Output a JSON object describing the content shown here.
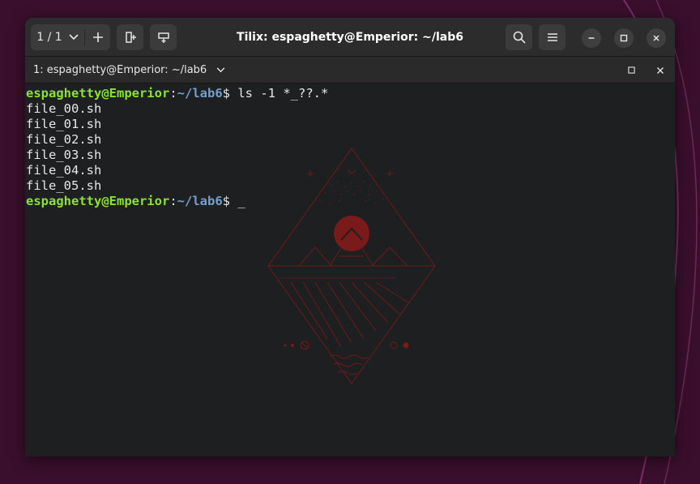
{
  "headerbar": {
    "session_label": "1 / 1",
    "title": "Tilix: espaghetty@Emperior: ~/lab6"
  },
  "tab": {
    "title": "1: espaghetty@Emperior: ~/lab6"
  },
  "terminal": {
    "prompt": {
      "user_host": "espaghetty@Emperior",
      "colon": ":",
      "path": "~/lab6",
      "symbol": "$ "
    },
    "command": "ls -1 *_??.*",
    "output": [
      "file_00.sh",
      "file_01.sh",
      "file_02.sh",
      "file_03.sh",
      "file_04.sh",
      "file_05.sh"
    ],
    "cursor": "_"
  },
  "colors": {
    "user_host": "#8ae234",
    "path": "#729fcf",
    "background": "#1e1f20",
    "headerbar": "#2c2c2c",
    "wallpaper_art": "#7a1a1a"
  },
  "icons": {
    "session_dropdown": "chevron-down-icon",
    "add_session": "plus-icon",
    "add_terminal_right": "split-right-icon",
    "add_terminal_down": "split-down-icon",
    "search": "search-icon",
    "menu": "hamburger-icon",
    "minimize": "minimize-icon",
    "maximize": "maximize-icon",
    "close": "close-icon",
    "tab_menu": "chevron-down-icon",
    "tab_maximize": "maximize-icon",
    "tab_close": "close-icon"
  }
}
